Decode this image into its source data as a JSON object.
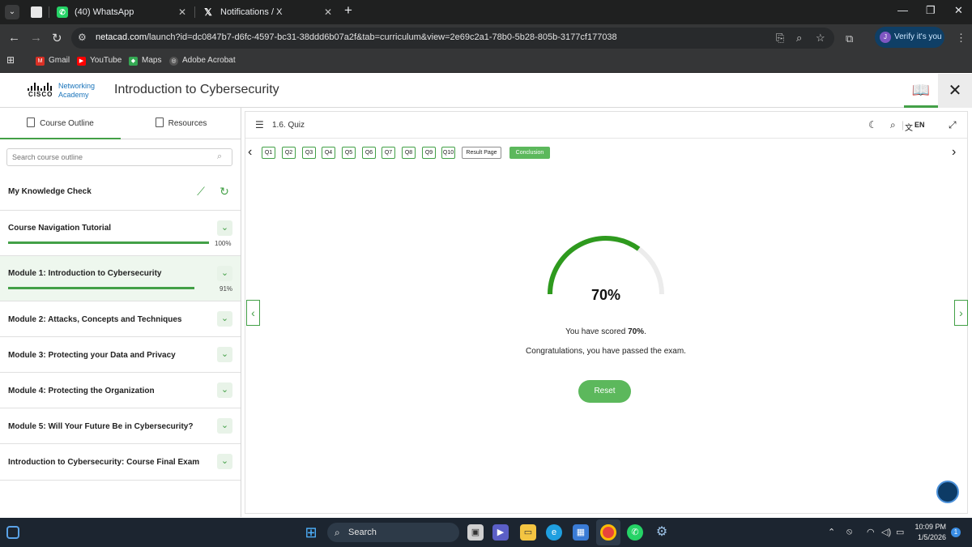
{
  "browser": {
    "tabs": [
      {
        "label": "(40) WhatsApp",
        "icon": "whatsapp-icon"
      },
      {
        "label": "Notifications / X",
        "icon": "x-logo-icon"
      }
    ],
    "url_host": "netacad.com",
    "url_path": "/launch?id=dc0847b7-d6fc-4597-bc31-38ddd6b07a2f&tab=curriculum&view=2e69c2a1-78b0-5b28-805b-3177cf177038",
    "verify_label": "Verify it's you",
    "bookmarks": [
      "Gmail",
      "YouTube",
      "Maps",
      "Adobe Acrobat"
    ]
  },
  "app": {
    "logo_cisco": "CISCO",
    "logo_line1": "Networking",
    "logo_line2": "Academy",
    "title": "Introduction to Cybersecurity"
  },
  "sidebar": {
    "tabs": [
      "Course Outline",
      "Resources"
    ],
    "search_placeholder": "Search course outline",
    "knowledge_check": "My Knowledge Check",
    "modules": [
      {
        "title": "Course Navigation Tutorial",
        "progress": "100%"
      },
      {
        "title": "Module 1: Introduction to Cybersecurity",
        "progress": "91%"
      },
      {
        "title": "Module 2: Attacks, Concepts and Techniques"
      },
      {
        "title": "Module 3: Protecting your Data and Privacy"
      },
      {
        "title": "Module 4: Protecting the Organization"
      },
      {
        "title": "Module 5: Will Your Future Be in Cybersecurity?"
      },
      {
        "title": "Introduction to Cybersecurity: Course Final Exam"
      }
    ]
  },
  "quiz": {
    "title": "1.6. Quiz",
    "lang": "EN",
    "nav": [
      "Q1",
      "Q2",
      "Q3",
      "Q4",
      "Q5",
      "Q6",
      "Q7",
      "Q8",
      "Q9",
      "Q10",
      "Result Page",
      "Conclusion"
    ],
    "active": "Conclusion",
    "score_value": 0.7,
    "score": "70%",
    "score_text_prefix": "You have scored ",
    "score_text_suffix": ".",
    "congrats": "Congratulations, you have passed the exam.",
    "reset": "Reset"
  },
  "taskbar": {
    "search": "Search",
    "time": "10:09 PM",
    "date": "1/5/2026",
    "notifications": "1"
  },
  "colors": {
    "accent": "#43a047",
    "gauge_fill": "#2e9a1e",
    "gauge_track": "#ececec"
  }
}
